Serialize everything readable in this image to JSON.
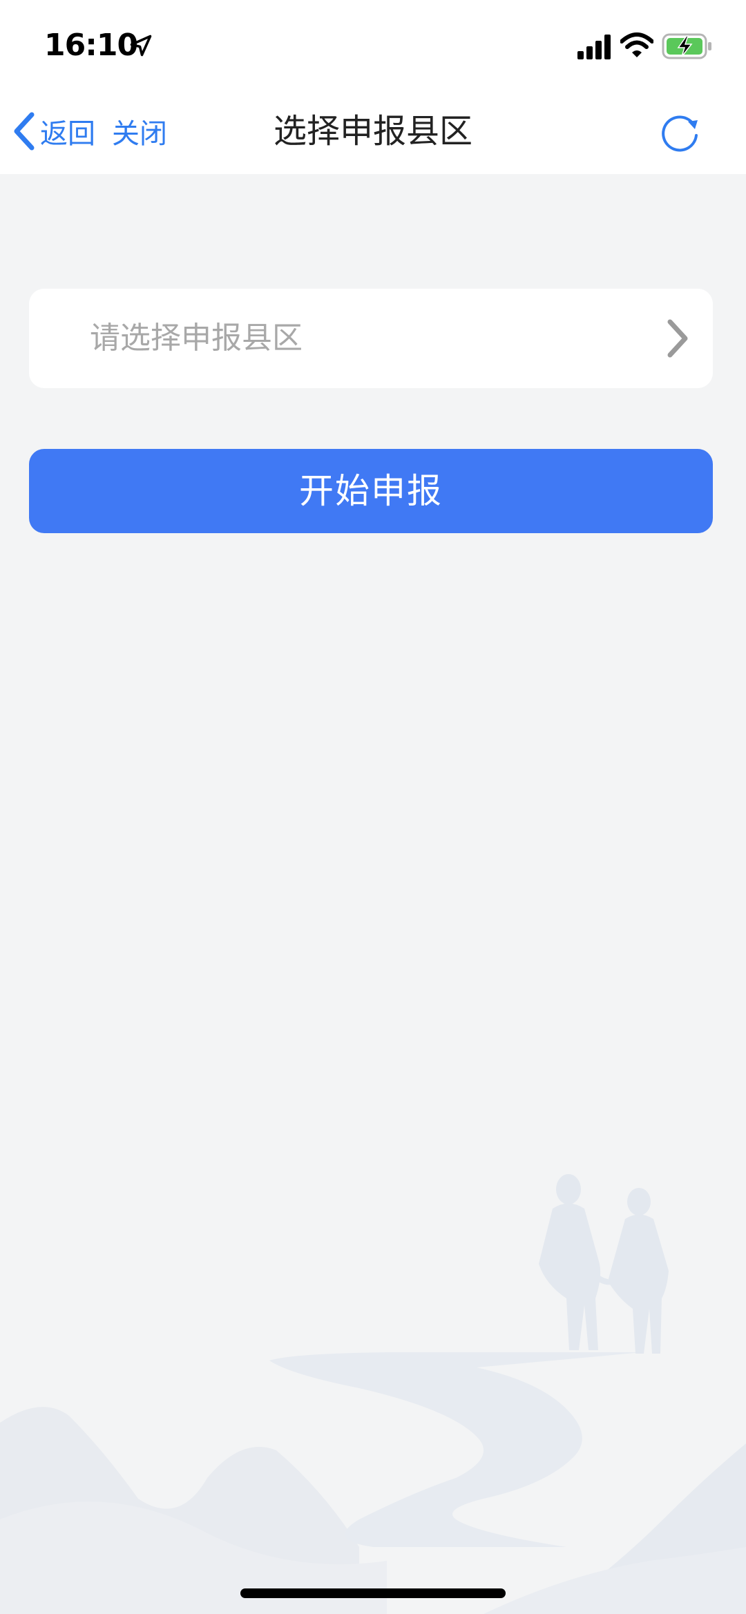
{
  "status_bar": {
    "time": "16:10",
    "icons": [
      "location-arrow-icon",
      "cellular-signal-icon",
      "wifi-icon",
      "battery-charging-icon"
    ]
  },
  "nav": {
    "back_label": "返回",
    "close_label": "关闭",
    "title": "选择申报县区",
    "refresh_icon": "refresh-icon"
  },
  "form": {
    "district_placeholder": "请选择申报县区",
    "start_label": "开始申报"
  },
  "colors": {
    "accent": "#2f7cf0",
    "primary_button": "#4079f4",
    "background": "#f3f4f5",
    "placeholder_text": "#a8a8a8"
  }
}
